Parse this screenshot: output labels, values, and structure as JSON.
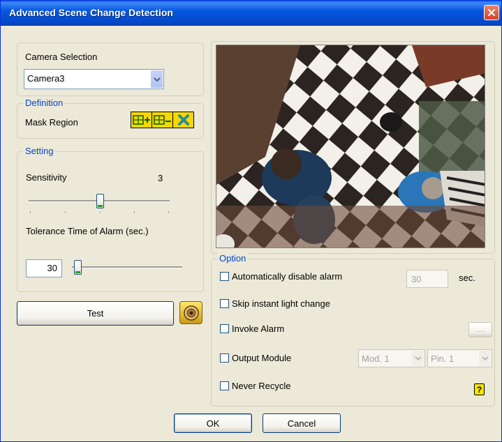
{
  "window": {
    "title": "Advanced Scene Change Detection"
  },
  "camera_selection": {
    "label": "Camera Selection",
    "value": "Camera3"
  },
  "definition": {
    "legend": "Definition",
    "mask_region_label": "Mask Region"
  },
  "setting": {
    "legend": "Setting",
    "sensitivity_label": "Sensitivity",
    "sensitivity_value": "3",
    "tolerance_label": "Tolerance Time of Alarm (sec.)",
    "tolerance_value": "30"
  },
  "test_button": "Test",
  "option": {
    "legend": "Option",
    "auto_disable_label": "Automatically disable alarm",
    "auto_disable_value": "30",
    "auto_disable_unit": "sec.",
    "skip_light_label": "Skip instant light change",
    "invoke_alarm_label": "Invoke Alarm",
    "invoke_alarm_browse": "....",
    "output_module_label": "Output Module",
    "module_value": "Mod. 1",
    "pin_value": "Pin. 1",
    "never_recycle_label": "Never Recycle",
    "help_badge": "?"
  },
  "footer": {
    "ok_label": "OK",
    "cancel_label": "Cancel"
  },
  "colors": {
    "accent": "#0046d5",
    "title_bar": "#0557e0",
    "face": "#ece9d8"
  },
  "icons": [
    "close-icon",
    "dropdown-arrow-icon",
    "mask-add-icon",
    "mask-remove-icon",
    "mask-clear-icon",
    "speaker-icon",
    "help-icon"
  ]
}
